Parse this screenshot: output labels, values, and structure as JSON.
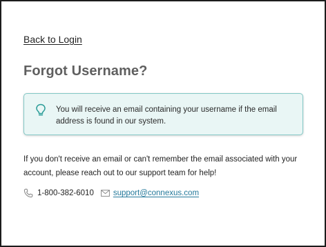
{
  "nav": {
    "back_label": "Back to Login"
  },
  "page": {
    "title": "Forgot Username?"
  },
  "info_box": {
    "icon": "lightbulb-icon",
    "message": "You will receive an email containing your username if the email address is found in our system."
  },
  "help": {
    "text": "If you don't receive an email or can't remember the email associated with your account, please reach out to our support team for help!"
  },
  "contact": {
    "phone_icon": "phone-icon",
    "phone": "1-800-382-6010",
    "email_icon": "mail-icon",
    "email": "support@connexus.com"
  },
  "colors": {
    "info_background": "#e9f6f5",
    "info_border": "#82c7c5",
    "link_accent": "#23789a",
    "title_gray": "#5f5f5f"
  }
}
